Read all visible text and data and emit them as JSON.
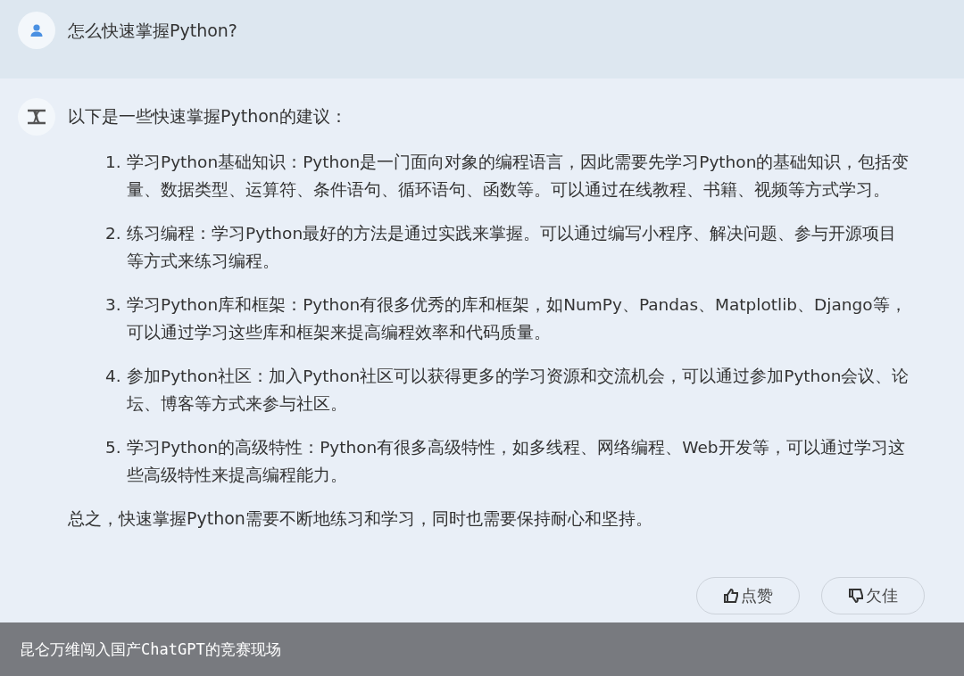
{
  "question": {
    "text": "怎么快速掌握Python?"
  },
  "answer": {
    "intro": "以下是一些快速掌握Python的建议：",
    "items": [
      {
        "number": "1.",
        "text": "学习Python基础知识：Python是一门面向对象的编程语言，因此需要先学习Python的基础知识，包括变量、数据类型、运算符、条件语句、循环语句、函数等。可以通过在线教程、书籍、视频等方式学习。"
      },
      {
        "number": "2.",
        "text": "练习编程：学习Python最好的方法是通过实践来掌握。可以通过编写小程序、解决问题、参与开源项目等方式来练习编程。"
      },
      {
        "number": "3.",
        "text": "学习Python库和框架：Python有很多优秀的库和框架，如NumPy、Pandas、Matplotlib、Django等，可以通过学习这些库和框架来提高编程效率和代码质量。"
      },
      {
        "number": "4.",
        "text": "参加Python社区：加入Python社区可以获得更多的学习资源和交流机会，可以通过参加Python会议、论坛、博客等方式来参与社区。"
      },
      {
        "number": "5.",
        "text": "学习Python的高级特性：Python有很多高级特性，如多线程、网络编程、Web开发等，可以通过学习这些高级特性来提高编程能力。"
      }
    ],
    "conclusion": "总之，快速掌握Python需要不断地练习和学习，同时也需要保持耐心和坚持。"
  },
  "feedback": [
    {
      "kind": "like",
      "label": "点赞"
    },
    {
      "kind": "dislike",
      "label": "欠佳"
    }
  ],
  "caption": "昆仑万维闯入国产ChatGPT的竞赛现场"
}
